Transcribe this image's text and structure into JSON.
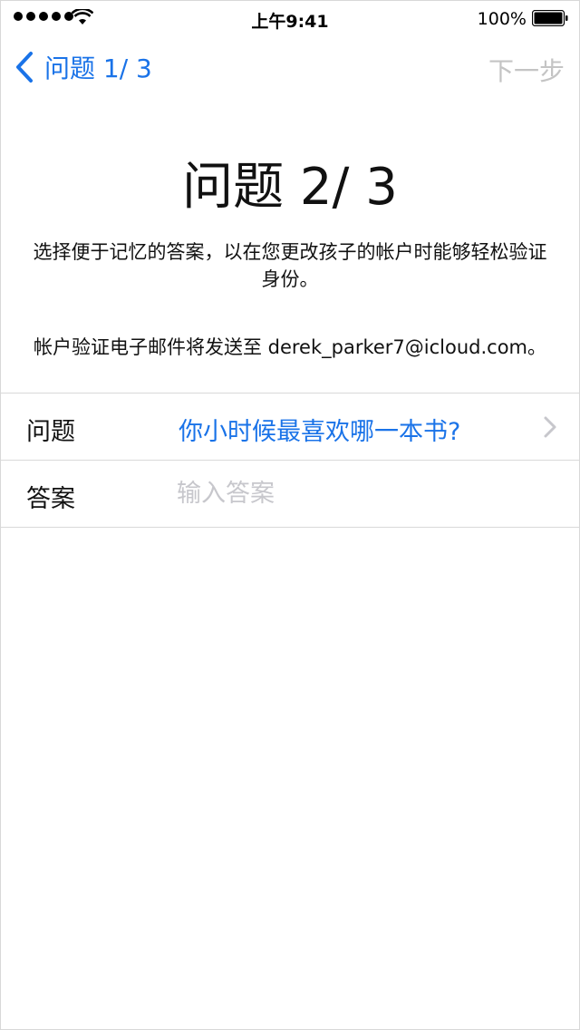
{
  "status_bar": {
    "time": "上午9:41",
    "battery_percent": "100%",
    "signal_bars": 5,
    "icons": [
      "signal-dots-icon",
      "wifi-icon",
      "battery-icon"
    ]
  },
  "nav": {
    "back_label": "问题 1/ 3",
    "next_label": "下一步",
    "back_icon": "chevron-left-icon"
  },
  "header": {
    "title": "问题 2/ 3",
    "description": "选择便于记忆的答案，以在您更改孩子的帐户时能够轻松验证身份。",
    "email_notice": "帐户验证电子邮件将发送至 derek_parker7@icloud.com。"
  },
  "form": {
    "question_label": "问题",
    "question_value": "你小时候最喜欢哪一本书?",
    "answer_label": "答案",
    "answer_placeholder": "输入答案",
    "answer_value": ""
  },
  "colors": {
    "accent": "#1a73e8",
    "disabled": "#c4c4c4",
    "separator": "#d9d9d9",
    "placeholder": "#c7c7cc"
  }
}
